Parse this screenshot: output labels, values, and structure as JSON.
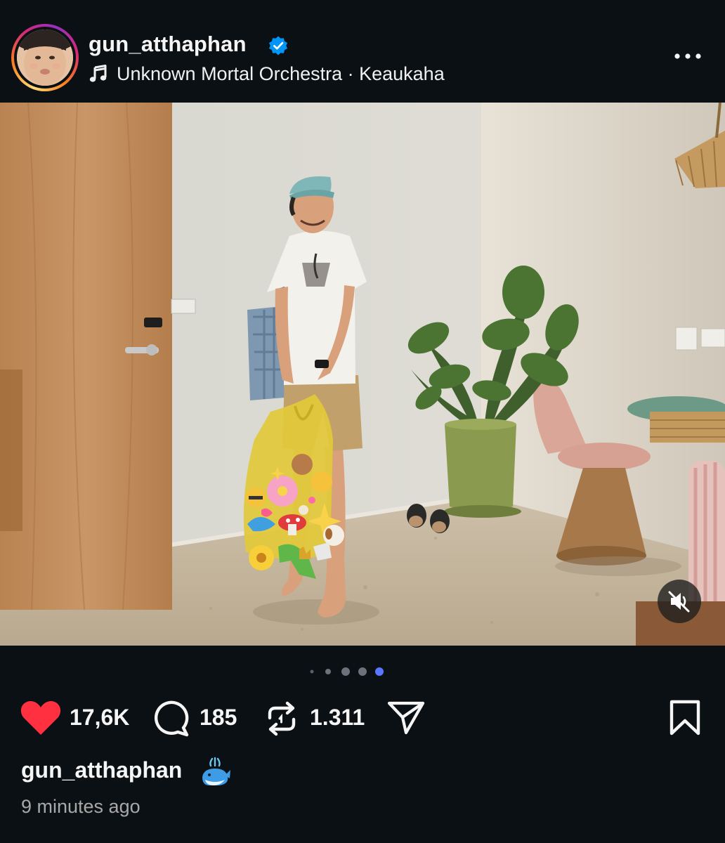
{
  "post": {
    "username": "gun_atthaphan",
    "verified": true,
    "audio": {
      "icon": "music-note-icon",
      "text": "Unknown Mortal Orchestra · Keaukaha"
    },
    "more_icon": "more-horizontal-icon"
  },
  "media": {
    "alt_icon": "mute-icon",
    "carousel_total": 5,
    "carousel_active": 5
  },
  "actions": {
    "likes": "17,6K",
    "comments": "185",
    "reposts": "1.311",
    "like_color": "#ff3040"
  },
  "caption": {
    "username": "gun_atthaphan",
    "emoji": "spouting-whale-emoji"
  },
  "timestamp": "9 minutes ago",
  "colors": {
    "background": "#0b1014",
    "text": "#f5f5f5",
    "muted_text": "#a8a8a8",
    "verified": "#0095f6",
    "active_dot": "#5b76ff"
  }
}
